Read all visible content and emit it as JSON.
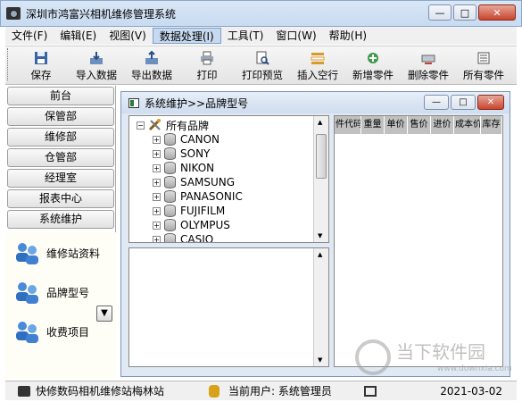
{
  "window": {
    "title": "深圳市鸿富兴相机维修管理系统",
    "controls": {
      "minimize": "—",
      "maximize": "□",
      "close": "✕"
    }
  },
  "menubar": [
    {
      "label": "文件(F)"
    },
    {
      "label": "编辑(E)"
    },
    {
      "label": "视图(V)"
    },
    {
      "label": "数据处理(I)",
      "active": true
    },
    {
      "label": "工具(T)"
    },
    {
      "label": "窗口(W)"
    },
    {
      "label": "帮助(H)"
    }
  ],
  "toolbar": [
    {
      "label": "保存",
      "icon": "floppy-icon"
    },
    {
      "label": "导入数据",
      "icon": "import-icon"
    },
    {
      "label": "导出数据",
      "icon": "export-icon"
    },
    {
      "label": "打印",
      "icon": "printer-icon"
    },
    {
      "label": "打印预览",
      "icon": "print-preview-icon"
    },
    {
      "label": "插入空行",
      "icon": "insert-row-icon"
    },
    {
      "label": "新增零件",
      "icon": "add-part-icon"
    },
    {
      "label": "删除零件",
      "icon": "delete-part-icon"
    },
    {
      "label": "所有零件",
      "icon": "all-parts-icon"
    }
  ],
  "nav": [
    {
      "label": "前台"
    },
    {
      "label": "保管部"
    },
    {
      "label": "维修部"
    },
    {
      "label": "仓管部"
    },
    {
      "label": "经理室"
    },
    {
      "label": "报表中心"
    },
    {
      "label": "系统维护"
    }
  ],
  "subnav": [
    {
      "label": "维修站资料",
      "icon": "users-icon"
    },
    {
      "label": "品牌型号",
      "icon": "users-icon"
    },
    {
      "label": "收费项目",
      "icon": "users-icon"
    }
  ],
  "child_window": {
    "title": "系统维护>>品牌型号",
    "controls": {
      "minimize": "—",
      "maximize": "□",
      "close": "✕"
    }
  },
  "tree": {
    "root": "所有品牌",
    "brands": [
      "CANON",
      "SONY",
      "NIKON",
      "SAMSUNG",
      "PANASONIC",
      "FUJIFILM",
      "OLYMPUS",
      "CASIO"
    ]
  },
  "grid": {
    "columns": [
      "件代码",
      "重量",
      "单价",
      "售价",
      "进价",
      "成本价",
      "库存"
    ]
  },
  "statusbar": {
    "station": "快修数码相机维修站梅林站",
    "user": "当前用户: 系统管理员",
    "date": "2021-03-02"
  },
  "watermark": {
    "text": "当下软件园",
    "url": "www.downxia.com"
  },
  "colors": {
    "titlebar": "#c8dbf1",
    "menu_active": "#c6d9ef",
    "close_button": "#c7452e",
    "subnav_bg": "#fffef6"
  }
}
